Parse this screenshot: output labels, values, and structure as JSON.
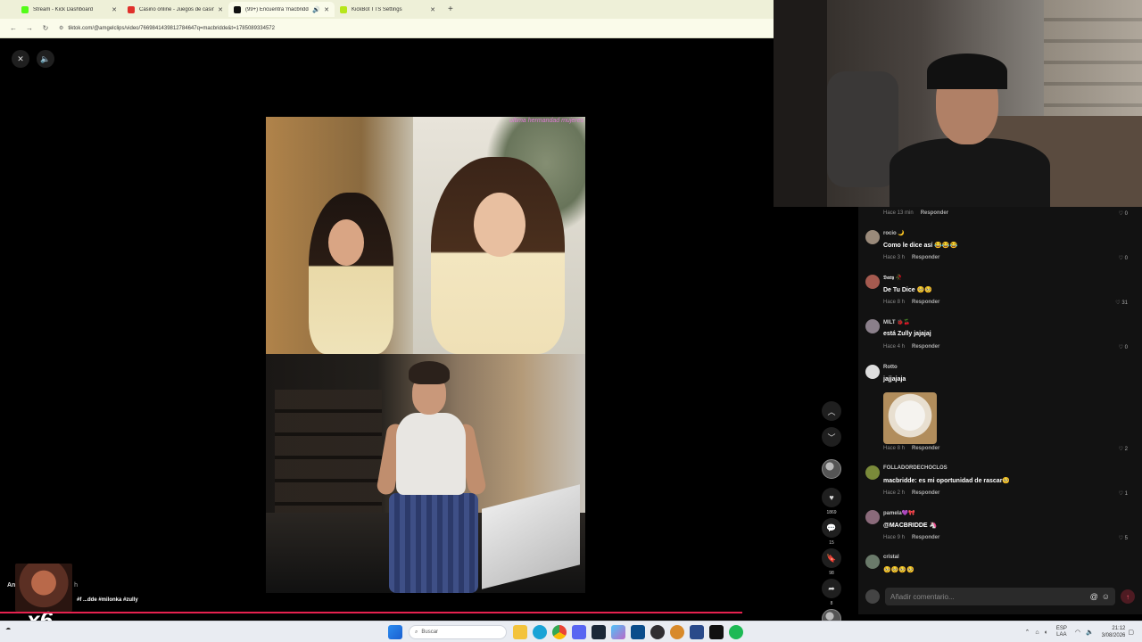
{
  "browser": {
    "tabs": [
      {
        "title": "Stream - Kick Dashboard",
        "favicon_color": "#53fc18",
        "active": false
      },
      {
        "title": "Casino online - Juegos de casino",
        "favicon_color": "#e0302a",
        "active": false
      },
      {
        "title": "(99+) Encuentra 'macbridde",
        "favicon_color": "#111111",
        "active": true
      },
      {
        "title": "KickBot TTS Settings",
        "favicon_color": "#b6e61b",
        "active": false
      }
    ],
    "url": "tiktok.com/@amgelclips/video/7669841439812784647q=macbridde&t=1785089334572"
  },
  "video": {
    "watermark": "ultima hermandad mujeres"
  },
  "rail": {
    "likes": "1869",
    "comments": "15",
    "saves": "98",
    "shares": "8"
  },
  "overlay": {
    "author": "An",
    "time": "9 h",
    "hashtags": "#f  ...dde #milonka #zully",
    "emote_count": "x6",
    "progress_fraction": 0.65
  },
  "comments": {
    "items": [
      {
        "user": "",
        "text": "",
        "meta": "Hace 13 min",
        "reply": "Responder",
        "likes": "0",
        "avatar": "#555555"
      },
      {
        "user": "rocio 🌙",
        "text": "Como le dice así 😂😂😂",
        "meta": "Hace 3 h",
        "reply": "Responder",
        "likes": "0",
        "avatar": "#9a8a7a"
      },
      {
        "user": "𝕯𝖆𝖗𝖞 🥀",
        "text": "De Tu Dice 🥺🥺",
        "meta": "Hace 8 h",
        "reply": "Responder",
        "likes": "31",
        "avatar": "#a55a4f"
      },
      {
        "user": "MILT 🐞🍒",
        "text": "está Zully jajajaj",
        "meta": "Hace 4 h",
        "reply": "Responder",
        "likes": "0",
        "avatar": "#8a7f8a"
      },
      {
        "user": "Rotto",
        "text": "jajjajaja",
        "meta": "Hace 8 h",
        "reply": "Responder",
        "likes": "2",
        "avatar": "#dddddd"
      },
      {
        "user": "FOLLADORDECHOCLOS",
        "text": "macbridde: es mi oportunidad de rascar🥺",
        "meta": "Hace 2 h",
        "reply": "Responder",
        "likes": "1",
        "avatar": "#7a8a3a"
      },
      {
        "user": "pamela💜🎀",
        "text": "@MACBRIDDE 🦄",
        "meta": "Hace 9 h",
        "reply": "Responder",
        "likes": "5",
        "avatar": "#8a6a7a"
      },
      {
        "user": "cristal",
        "text": "🥺🥺🥺🥺",
        "meta": "",
        "reply": "",
        "likes": "",
        "avatar": "#6a7a6a"
      }
    ],
    "input_placeholder": "Añadir comentario..."
  },
  "taskbar": {
    "search_placeholder": "Buscar",
    "lang_top": "ESP",
    "lang_bottom": "LAA",
    "time": "21:12",
    "date": "3/08/2026"
  }
}
